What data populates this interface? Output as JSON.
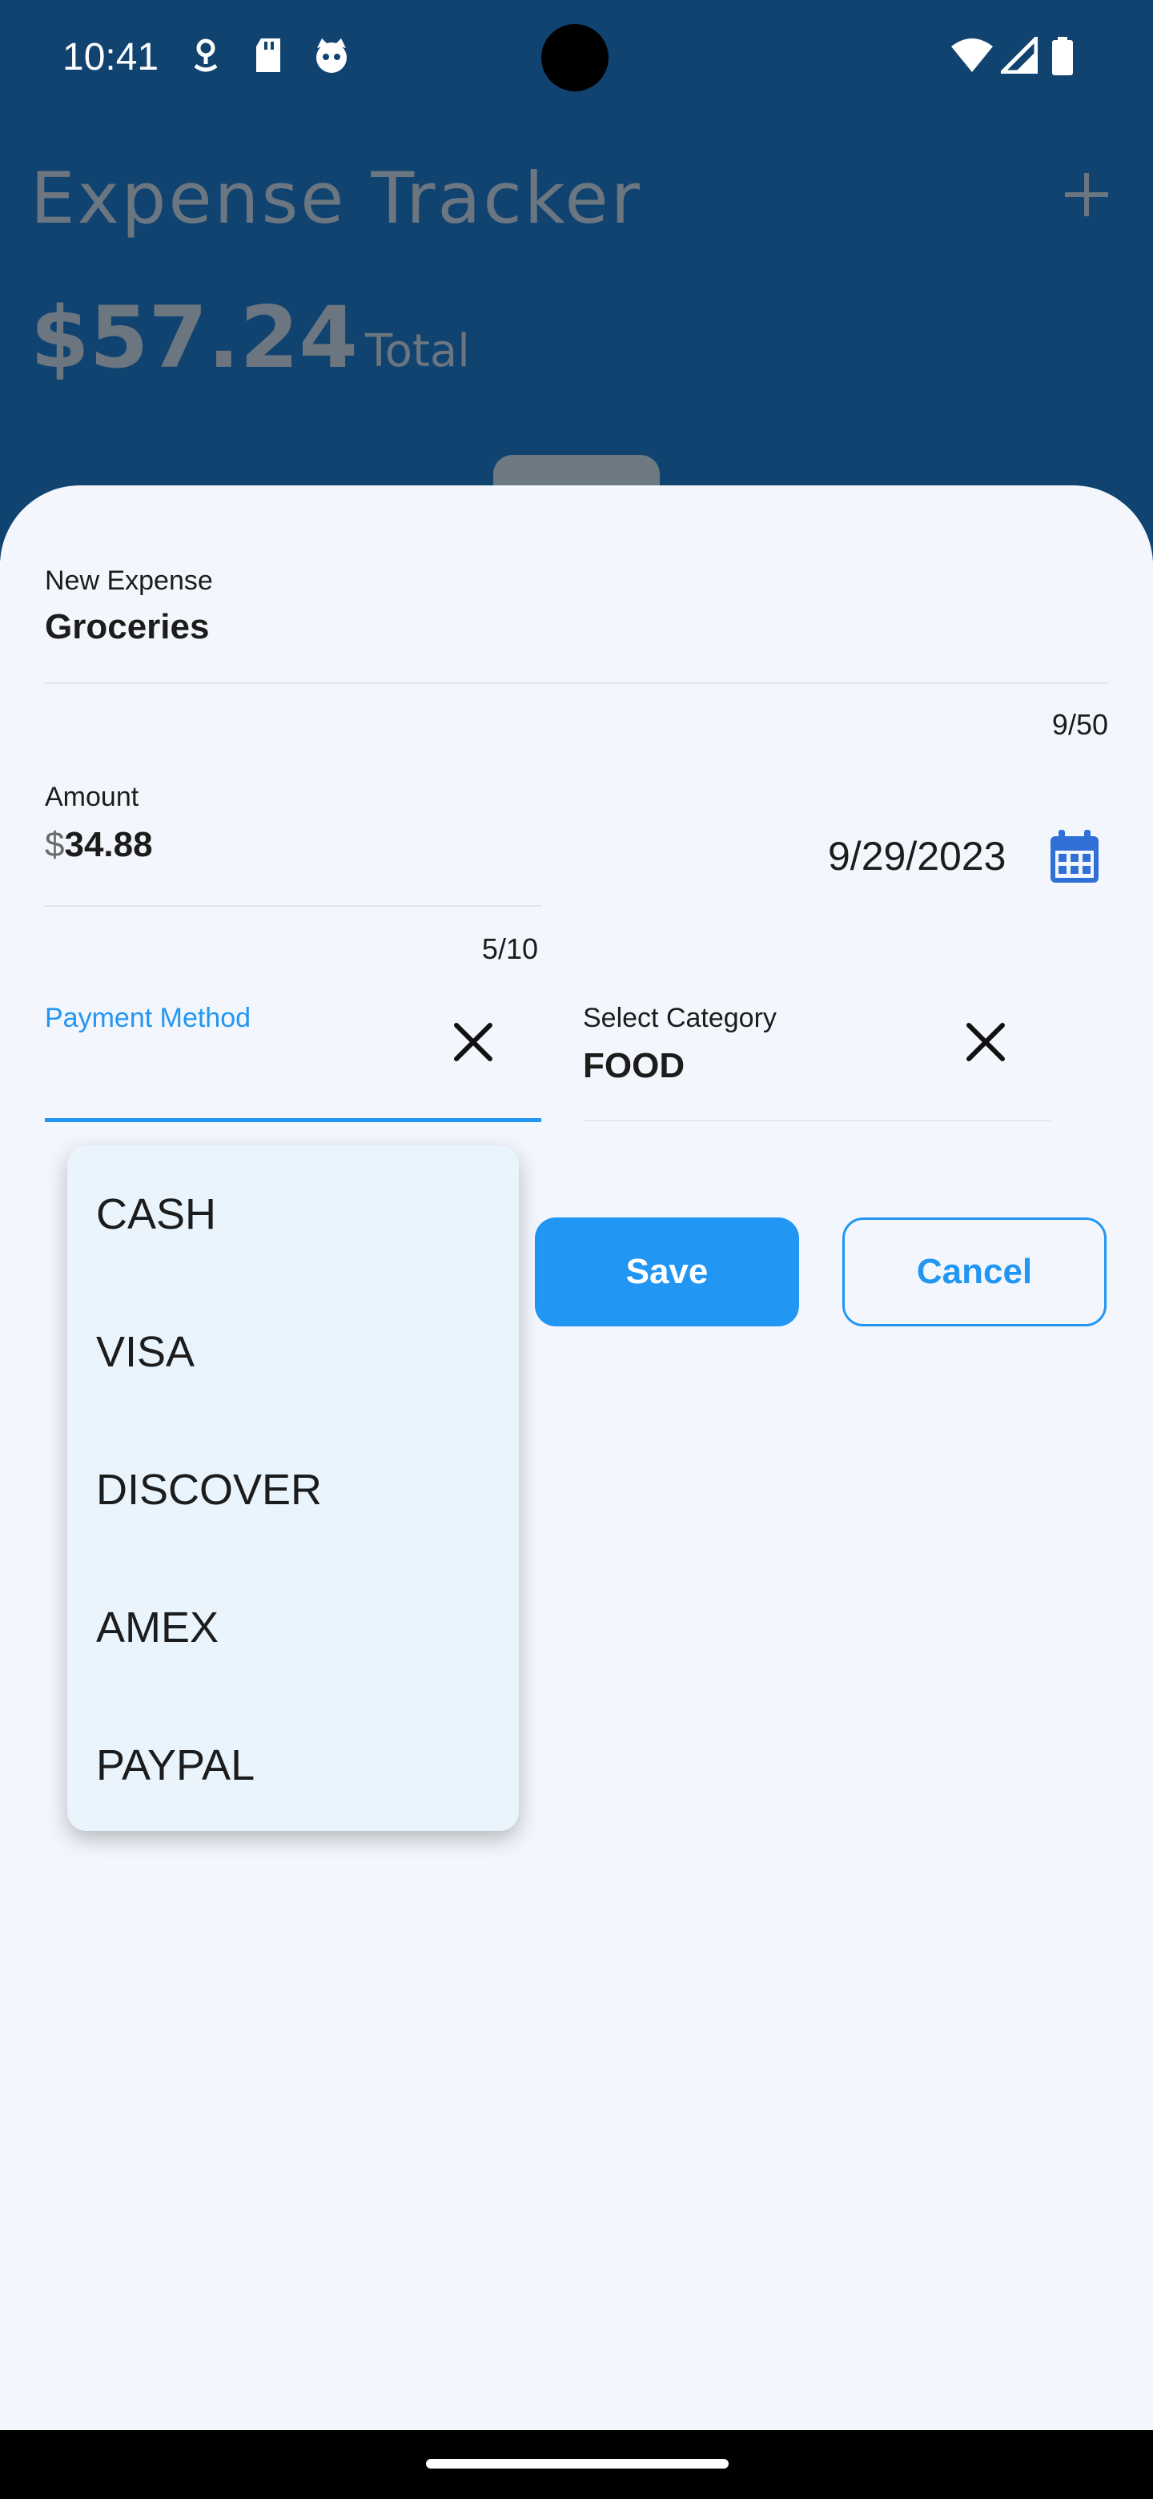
{
  "status_bar": {
    "time": "10:41",
    "left_icons": [
      "location-icon",
      "sd-card-icon",
      "cat-face-icon"
    ],
    "right_icons": [
      "wifi-icon",
      "signal-icon",
      "battery-icon"
    ]
  },
  "app": {
    "title": "Expense Tracker",
    "total_amount": "$57.24",
    "total_label": "- Total",
    "add_icon": "plus-icon"
  },
  "form": {
    "expense_name": {
      "label": "New Expense",
      "value": "Groceries",
      "counter": "9/50"
    },
    "amount": {
      "label": "Amount",
      "currency_prefix": "$",
      "value": "34.88",
      "counter": "5/10"
    },
    "date": {
      "value": "9/29/2023",
      "icon": "calendar-icon"
    },
    "payment_method": {
      "label": "Payment Method",
      "value": ""
    },
    "category": {
      "label": "Select Category",
      "value": "FOOD"
    }
  },
  "buttons": {
    "save_label": "Save",
    "cancel_label": "Cancel"
  },
  "dropdown": {
    "options": [
      "CASH",
      "VISA",
      "DISCOVER",
      "AMEX",
      "PAYPAL"
    ]
  },
  "colors": {
    "header_bg": "#104370",
    "accent": "#2196f3",
    "sheet_bg": "#f3f7fd",
    "dropdown_bg": "#e9f4fc"
  }
}
